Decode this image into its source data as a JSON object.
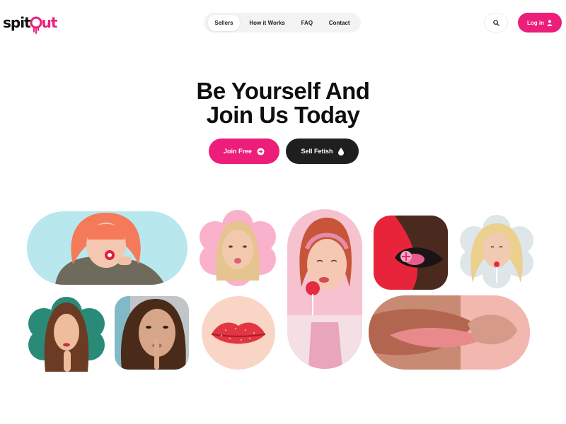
{
  "brand": {
    "part1": "spit",
    "part2": "ut",
    "accent": "#ec1e79"
  },
  "nav": {
    "items": [
      {
        "label": "Sellers",
        "active": true
      },
      {
        "label": "How it Works"
      },
      {
        "label": "FAQ"
      },
      {
        "label": "Contact"
      }
    ]
  },
  "header": {
    "search_icon": "search-icon",
    "login_label": "Log in",
    "login_icon": "user-icon"
  },
  "hero": {
    "title_line1": "Be Yourself And",
    "title_line2": "Join Us Today",
    "join_label": "Join Free",
    "join_icon": "arrow-right-circle-icon",
    "sell_label": "Sell Fetish",
    "sell_icon": "droplet-icon"
  },
  "colors": {
    "pink": "#ec1e79",
    "dark": "#1f1f1f"
  }
}
